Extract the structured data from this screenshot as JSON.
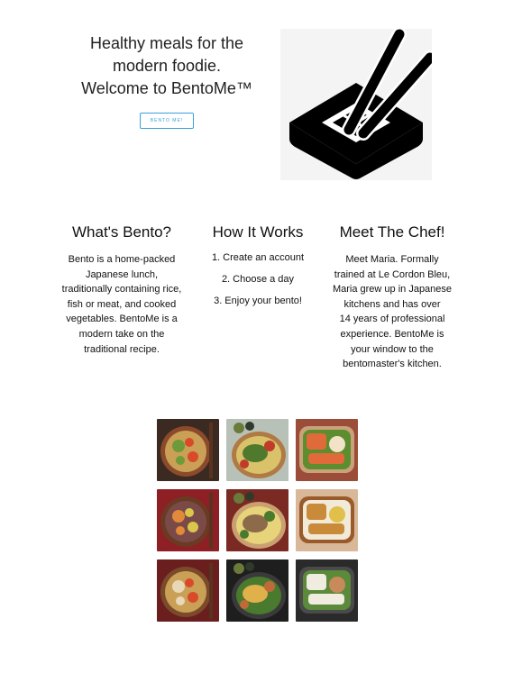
{
  "hero": {
    "title_lines": [
      "Healthy meals for the",
      "modern foodie.",
      "Welcome to BentoMe™"
    ],
    "cta_label": "BENTO ME!"
  },
  "logo": {
    "icon": "bento-box-with-chopsticks-icon"
  },
  "sections": [
    {
      "heading": "What's Bento?",
      "lines": [
        "Bento is a home-packed",
        "Japanese lunch,",
        "traditionally containing rice,",
        "fish or meat, and cooked",
        "vegetables. BentoMe is a",
        "modern take on the",
        "traditional recipe."
      ]
    },
    {
      "heading": "How It Works",
      "steps": [
        "1. Create an account",
        "2. Choose a day",
        "3. Enjoy your bento!"
      ]
    },
    {
      "heading": "Meet The Chef!",
      "lines": [
        "Meet Maria. Formally",
        "trained at Le Cordon Bleu,",
        "Maria grew up in Japanese",
        "kitchens and has over",
        "14 years of professional",
        "experience. BentoMe is",
        "your window to the",
        "bentomaster's kitchen."
      ]
    }
  ],
  "gallery": {
    "tiles": [
      {
        "name": "bento-photo-1",
        "bg": "#3a2a22",
        "box": "#8b4a2b",
        "food": [
          "#c9a055",
          "#6e9a3a",
          "#d84a2a"
        ]
      },
      {
        "name": "bento-photo-2",
        "bg": "#b8c1b8",
        "box": "#b07a45",
        "food": [
          "#4f7a2e",
          "#d9c26a",
          "#c23a2a"
        ]
      },
      {
        "name": "bento-photo-3",
        "bg": "#9c4d3a",
        "box": "#c9a27a",
        "food": [
          "#e06a3a",
          "#5c8d2e",
          "#f2e2c8"
        ]
      },
      {
        "name": "bento-photo-4",
        "bg": "#8e1f25",
        "box": "#6b3a22",
        "food": [
          "#7a4a48",
          "#e08a3a",
          "#d9c64a"
        ]
      },
      {
        "name": "bento-photo-5",
        "bg": "#7a2a22",
        "box": "#caa070",
        "food": [
          "#8d6a4a",
          "#e6d37a",
          "#4a7a2e"
        ]
      },
      {
        "name": "bento-photo-6",
        "bg": "#d9b89a",
        "box": "#9a5a2a",
        "food": [
          "#c98a3a",
          "#f2ead8",
          "#e0c04a"
        ]
      },
      {
        "name": "bento-photo-7",
        "bg": "#6a1e1e",
        "box": "#7a4a2a",
        "food": [
          "#c9a055",
          "#e8d8b8",
          "#d94a2a"
        ]
      },
      {
        "name": "bento-photo-8",
        "bg": "#1e1e1e",
        "box": "#3a3a3a",
        "food": [
          "#e0b04a",
          "#4a7a2e",
          "#c06a3a"
        ]
      },
      {
        "name": "bento-photo-9",
        "bg": "#2a2a2a",
        "box": "#4a4a4a",
        "food": [
          "#f0ece0",
          "#5a8a3a",
          "#c98a5a"
        ]
      }
    ]
  }
}
